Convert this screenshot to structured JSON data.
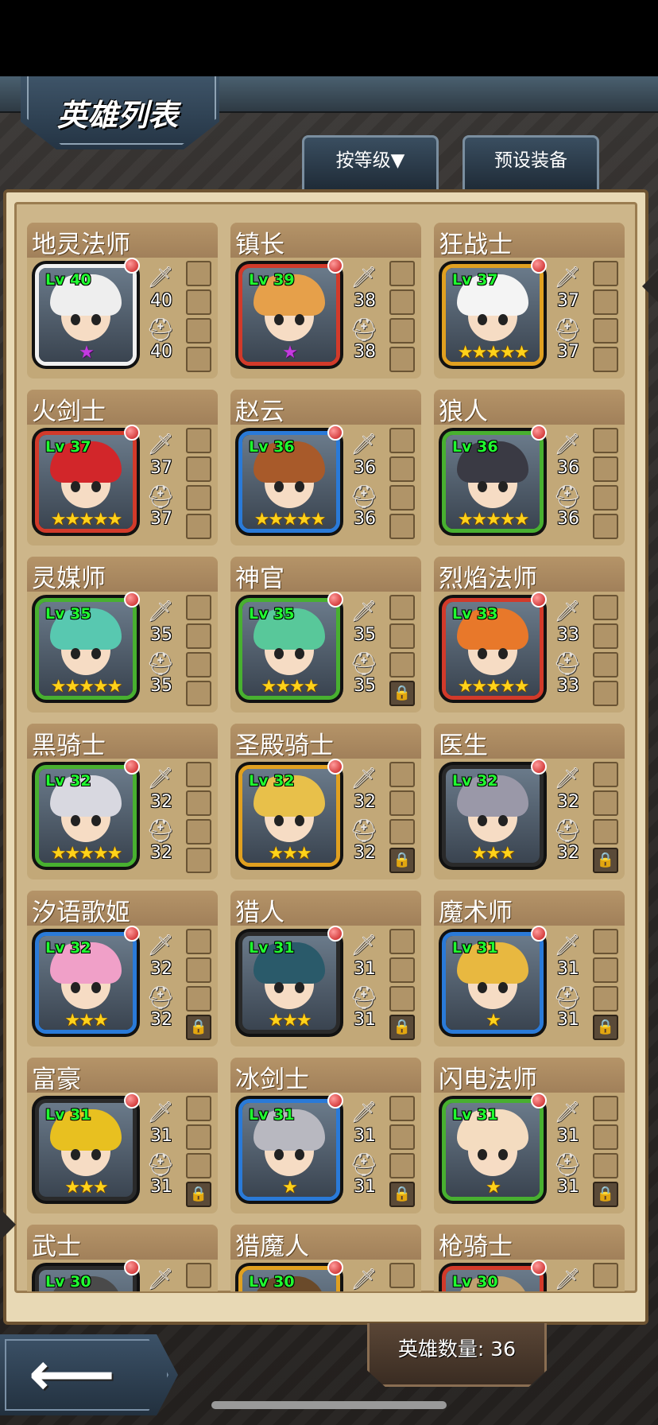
{
  "header": {
    "title": "英雄列表"
  },
  "tabs": {
    "sort_label": "按等级▼",
    "preset_label": "预设装备"
  },
  "footer": {
    "hero_count": "英雄数量: 36"
  },
  "heroes": [
    {
      "name": "地灵法师",
      "lv": "Lv 40",
      "weapon": "40",
      "armor": "40",
      "stars": 1,
      "star_color": "purple",
      "frame": "#f0f0f0",
      "hair": "#eeeeee",
      "locked": false
    },
    {
      "name": "镇长",
      "lv": "Lv 39",
      "weapon": "38",
      "armor": "38",
      "stars": 1,
      "star_color": "purple",
      "frame": "#d23a2a",
      "hair": "#e6a04a",
      "locked": false
    },
    {
      "name": "狂战士",
      "lv": "Lv 37",
      "weapon": "37",
      "armor": "37",
      "stars": 5,
      "star_color": "gold",
      "frame": "#e0a020",
      "hair": "#f4f4f4",
      "locked": false
    },
    {
      "name": "火剑士",
      "lv": "Lv 37",
      "weapon": "37",
      "armor": "37",
      "stars": 5,
      "star_color": "gold",
      "frame": "#d23a2a",
      "hair": "#d2262a",
      "locked": false
    },
    {
      "name": "赵云",
      "lv": "Lv 36",
      "weapon": "36",
      "armor": "36",
      "stars": 5,
      "star_color": "gold",
      "frame": "#2a7ad8",
      "hair": "#a85a2a",
      "locked": false
    },
    {
      "name": "狼人",
      "lv": "Lv 36",
      "weapon": "36",
      "armor": "36",
      "stars": 5,
      "star_color": "gold",
      "frame": "#48b030",
      "hair": "#3a3a44",
      "locked": false
    },
    {
      "name": "灵媒师",
      "lv": "Lv 35",
      "weapon": "35",
      "armor": "35",
      "stars": 5,
      "star_color": "gold",
      "frame": "#48b030",
      "hair": "#58c8b0",
      "locked": false
    },
    {
      "name": "神官",
      "lv": "Lv 35",
      "weapon": "35",
      "armor": "35",
      "stars": 4,
      "star_color": "gold",
      "frame": "#48b030",
      "hair": "#58c89a",
      "locked": true
    },
    {
      "name": "烈焰法师",
      "lv": "Lv 33",
      "weapon": "33",
      "armor": "33",
      "stars": 5,
      "star_color": "gold",
      "frame": "#d23a2a",
      "hair": "#e8782a",
      "locked": false
    },
    {
      "name": "黑骑士",
      "lv": "Lv 32",
      "weapon": "32",
      "armor": "32",
      "stars": 5,
      "star_color": "gold",
      "frame": "#48b030",
      "hair": "#d8d8e0",
      "locked": false
    },
    {
      "name": "圣殿骑士",
      "lv": "Lv 32",
      "weapon": "32",
      "armor": "32",
      "stars": 3,
      "star_color": "gold",
      "frame": "#e0a020",
      "hair": "#e8c04a",
      "locked": true
    },
    {
      "name": "医生",
      "lv": "Lv 32",
      "weapon": "32",
      "armor": "32",
      "stars": 3,
      "star_color": "gold",
      "frame": "#2a2a2a",
      "hair": "#9a98a8",
      "locked": true
    },
    {
      "name": "汐语歌姬",
      "lv": "Lv 32",
      "weapon": "32",
      "armor": "32",
      "stars": 3,
      "star_color": "gold",
      "frame": "#2a7ad8",
      "hair": "#f0a0c8",
      "locked": true
    },
    {
      "name": "猎人",
      "lv": "Lv 31",
      "weapon": "31",
      "armor": "31",
      "stars": 3,
      "star_color": "gold",
      "frame": "#2a2a2a",
      "hair": "#2a5a6a",
      "locked": true
    },
    {
      "name": "魔术师",
      "lv": "Lv 31",
      "weapon": "31",
      "armor": "31",
      "stars": 1,
      "star_color": "gold",
      "frame": "#2a7ad8",
      "hair": "#e8b840",
      "locked": true
    },
    {
      "name": "富豪",
      "lv": "Lv 31",
      "weapon": "31",
      "armor": "31",
      "stars": 3,
      "star_color": "gold",
      "frame": "#2a2a2a",
      "hair": "#e8c020",
      "locked": true
    },
    {
      "name": "冰剑士",
      "lv": "Lv 31",
      "weapon": "31",
      "armor": "31",
      "stars": 1,
      "star_color": "gold",
      "frame": "#2a7ad8",
      "hair": "#b8b8c0",
      "locked": true
    },
    {
      "name": "闪电法师",
      "lv": "Lv 31",
      "weapon": "31",
      "armor": "31",
      "stars": 1,
      "star_color": "gold",
      "frame": "#48b030",
      "hair": "#f4dcc0",
      "locked": true
    },
    {
      "name": "武士",
      "lv": "Lv 30",
      "weapon": "",
      "armor": "",
      "stars": 0,
      "star_color": "gold",
      "frame": "#2a2a2a",
      "hair": "#4a4a4a",
      "locked": false
    },
    {
      "name": "猎魔人",
      "lv": "Lv 30",
      "weapon": "",
      "armor": "",
      "stars": 0,
      "star_color": "gold",
      "frame": "#e0a020",
      "hair": "#6a4a2a",
      "locked": false
    },
    {
      "name": "枪骑士",
      "lv": "Lv 30",
      "weapon": "",
      "armor": "",
      "stars": 0,
      "star_color": "gold",
      "frame": "#d23a2a",
      "hair": "#c0a070",
      "locked": false
    }
  ]
}
